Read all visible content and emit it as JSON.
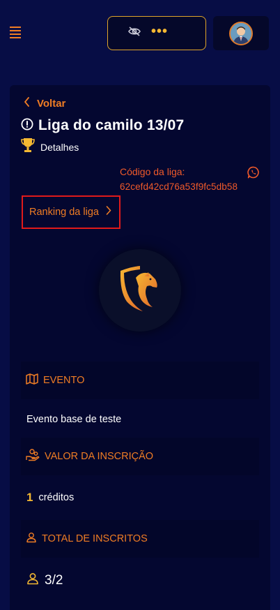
{
  "header": {
    "menu_icon": "hamburger-icon",
    "balance_hidden_icon": "eye-off-icon",
    "balance_masked": "•••",
    "avatar_icon": "user-avatar"
  },
  "league": {
    "back_label": "Voltar",
    "title": "Liga do camilo 13/07",
    "details_label": "Detalhes",
    "code_label": "Código da liga:",
    "code_value": "62cefd42cd76a53f9fc5db58",
    "ranking_label": "Ranking da liga"
  },
  "sections": {
    "event": {
      "header": "EVENTO",
      "value": "Evento base de teste"
    },
    "fee": {
      "header": "VALOR DA INSCRIÇÃO",
      "amount": "1",
      "unit": "créditos"
    },
    "subscribers": {
      "header": "TOTAL DE INSCRITOS",
      "value": "3/2"
    }
  },
  "colors": {
    "background": "#070d45",
    "card": "#040730",
    "accent_orange": "#f07d24",
    "code_red": "#f05a2a",
    "gold": "#f4b832",
    "highlight_border": "#e11a1a"
  }
}
